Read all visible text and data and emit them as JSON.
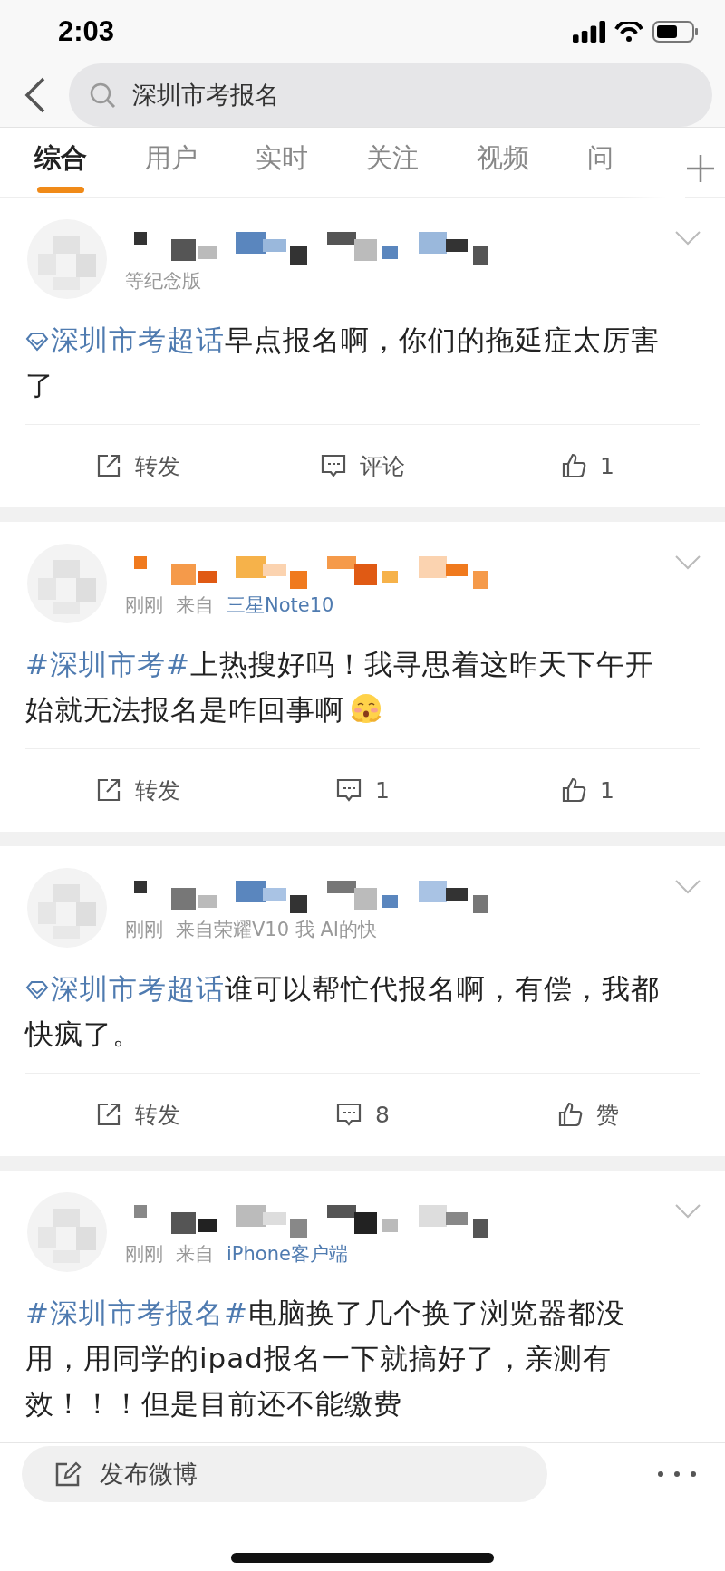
{
  "status_bar": {
    "time": "2:03"
  },
  "search": {
    "value": "深圳市考报名"
  },
  "tabs": [
    {
      "label": "综合",
      "selected": true
    },
    {
      "label": "用户",
      "selected": false
    },
    {
      "label": "实时",
      "selected": false
    },
    {
      "label": "关注",
      "selected": false
    },
    {
      "label": "视频",
      "selected": false
    },
    {
      "label": "问",
      "selected": false
    }
  ],
  "posts": [
    {
      "meta": [
        {
          "text": "等纪念版",
          "link": false
        }
      ],
      "tag": {
        "kind": "supertopic",
        "text": "深圳市考超话"
      },
      "text": "早点报名啊，你们的拖延症太厉害了",
      "emoji": false,
      "actions": {
        "repost": "转发",
        "comment": "评论",
        "like": "1"
      }
    },
    {
      "meta": [
        {
          "text": "刚刚",
          "link": false
        },
        {
          "text": "来自",
          "link": false
        },
        {
          "text": "三星Note10",
          "link": true
        }
      ],
      "tag": {
        "kind": "hashtag",
        "text": "#深圳市考#"
      },
      "text": "上热搜好吗！我寻思着这昨天下午开始就无法报名是咋回事啊",
      "emoji": true,
      "actions": {
        "repost": "转发",
        "comment": "1",
        "like": "1"
      }
    },
    {
      "meta": [
        {
          "text": "刚刚",
          "link": false
        },
        {
          "text": "来自荣耀V10 我 AI的快",
          "link": false
        }
      ],
      "tag": {
        "kind": "supertopic",
        "text": "深圳市考超话"
      },
      "text": "谁可以帮忙代报名啊，有偿，我都快疯了。",
      "emoji": false,
      "actions": {
        "repost": "转发",
        "comment": "8",
        "like": "赞"
      }
    },
    {
      "meta": [
        {
          "text": "刚刚",
          "link": false
        },
        {
          "text": "来自",
          "link": false
        },
        {
          "text": "iPhone客户端",
          "link": true
        }
      ],
      "tag": {
        "kind": "hashtag",
        "text": "#深圳市考报名#"
      },
      "text": "电脑换了几个换了浏览器都没用，用同学的ipad报名一下就搞好了，亲测有效！！！但是目前还不能缴费",
      "emoji": false
    }
  ],
  "compose": {
    "label": "发布微博"
  }
}
